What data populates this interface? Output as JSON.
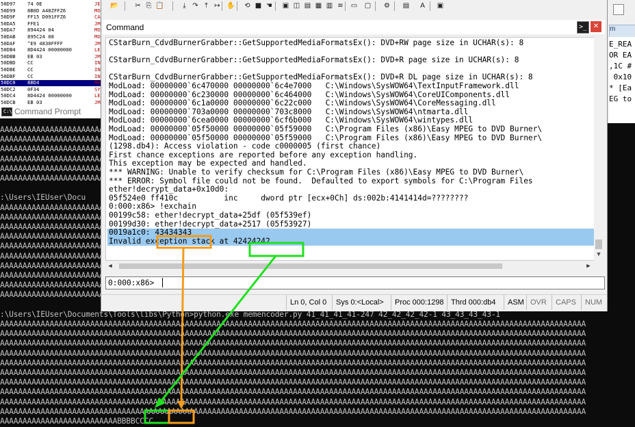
{
  "disasm": {
    "rows": [
      {
        "addr": "50D97",
        "ins": "74 0E"
      },
      {
        "addr": "50D99",
        "ins": "8B0D A48ZFFZ6"
      },
      {
        "addr": "50D9F",
        "ins": "FF15 D091FFZ6"
      },
      {
        "addr": "50DA5",
        "ins": "FFE1"
      },
      {
        "addr": "50DA7",
        "ins": "894424 04"
      },
      {
        "addr": "50DAB",
        "ins": "895C24 08"
      },
      {
        "addr": "50DAF",
        "ins": "^E9 4830FFFF"
      },
      {
        "addr": "50DB4",
        "ins": "8D4424 00000000"
      },
      {
        "addr": "50DBB",
        "ins": "EB 03"
      },
      {
        "addr": "50DBD",
        "ins": "CC"
      },
      {
        "addr": "50DBE",
        "ins": "CC"
      },
      {
        "addr": "50DBF",
        "ins": "CC"
      },
      {
        "addr": "50DC0",
        "ins": "8BD4"
      },
      {
        "addr": "50DC2",
        "ins": "0F34"
      },
      {
        "addr": "50DC4",
        "ins": "8D4424 00000000"
      },
      {
        "addr": "50DCB",
        "ins": "EB 03"
      }
    ],
    "mnemonics": [
      "JE",
      "MO",
      "CA",
      "JM",
      "MO",
      "MO",
      "JM",
      "LE",
      "JM",
      "IN",
      "IN",
      "IN",
      "MO",
      "SY",
      "LE",
      "JM"
    ]
  },
  "console": {
    "title": "Command Prompt",
    "lines": [
      "AAAAAAAAAAAAAAAAAAAAAAAAAA",
      "AAAAAAAAAAAAAAAAAAAAAAAAAA",
      "AAAAAAAAAAAAAAAAAAAAAAAAAA",
      "AAAAAAAAAAAAAAAAAAAAAAAAAA",
      "AAAAAAAAAAAAAAAAAAAAAAAAAA",
      "AAAAAAAAAAAAAAAAAAAAAAAAAA",
      "",
      ":\\Users\\IEUser\\Docu",
      "AAAAAAAAAAAAAAAAAAAAAAAAAA",
      "AAAAAAAAAAAAAAAAAAAAAAAAAA",
      "AAAAAAAAAAAAAAAAAAAAAAAAAA",
      "AAAAAAAAAAAAAAAAAAAAAAAAAA",
      "AAAAAAAAAAAAAAAAAAAAAAAAAA",
      "AAAAAAAAAAAAAAAAAAAAAAAAAA",
      "AAAAAAAAAAAAAAAAAAAAAAAAAA",
      "AAAAAAAAAAAAAAAAAAAAAAAAAA",
      "AAAAAAAAAAAAAAAAAAAAAAAAAA",
      "AAAAAAAAAAAAAAAAAAAAAAAAAA",
      "",
      ":\\Users\\IEUser\\Documents\\Tools\\libs\\Python>python.exe memencoder.py 41_41_41_41-247 42_42_42_42-1 43_43_43_43-1",
      "AAAAAAAAAAAAAAAAAAAAAAAAAAAAAAAAAAAAAAAAAAAAAAAAAAAAAAAAAAAAAAAAAAAAAAAAAAAAAAAAAAAAAAAAAAAAAAAAAAAAAAAAAAAAAAAAAAAAAAAAAAAAAAAAAA",
      "AAAAAAAAAAAAAAAAAAAAAAAAAAAAAAAAAAAAAAAAAAAAAAAAAAAAAAAAAAAAAAAAAAAAAAAAAAAAAAAAAAAAAAAAAAAAAAAAAAAAAAAAAAAAAAAAAAAAAAAAAAAAAAAAAA",
      "AAAAAAAAAAAAAAAAAAAAAAAAAAAAAAAAAAAAAAAAAAAAAAAAAAAAAAAAAAAAAAAAAAAAAAAAAAAAAAAAAAAAAAAAAAAAAAAAAAAAAAAAAAAAAAAAAAAAAAAAAAAAAAAAAA",
      "AAAAAAAAAAAAAAAAAAAAAAAAAAAAAAAAAAAAAAAAAAAAAAAAAAAAAAAAAAAAAAAAAAAAAAAAAAAAAAAAAAAAAAAAAAAAAAAAAAAAAAAAAAAAAAAAAAAAAAAAAAAAAAAAAA",
      "AAAAAAAAAAAAAAAAAAAAAAAAAAAAAAAAAAAAAAAAAAAAAAAAAAAAAAAAAAAAAAAAAAAAAAAAAAAAAAAAAAAAAAAAAAAAAAAAAAAAAAAAAAAAAAAAAAAAAAAAAAAAAAAAAA",
      "AAAAAAAAAAAAAAAAAAAAAAAAAAAAAAAAAAAAAAAAAAAAAAAAAAAAAAAAAAAAAAAAAAAAAAAAAAAAAAAAAAAAAAAAAAAAAAAAAAAAAAAAAAAAAAAAAAAAAAAAAAAAAAAAAA",
      "AAAAAAAAAAAAAAAAAAAAAAAAAAAAAAAAAAAAAAAAAAAAAAAAAAAAAAAAAAAAAAAAAAAAAAAAAAAAAAAAAAAAAAAAAAAAAAAAAAAAAAAAAAAAAAAAAAAAAAAAAAAAAAAAAA",
      "AAAAAAAAAAAAAAAAAAAAAAAAAAAAAAAAAAAAAAAAAAAAAAAAAAAAAAAAAAAAAAAAAAAAAAAAAAAAAAAAAAAAAAAAAAAAAAAAAAAAAAAAAAAAAAAAAAAAAAAAAAAAAAAAAA",
      "AAAAAAAAAAAAAAAAAAAAAAAAAAAAAAAAAAAAAAAAAAAAAAAAAAAAAAAAAAAAAAAAAAAAAAAAAAAAAAAAAAAAAAAAAAAAAAAAAAAAAAAAAAAAAAAAAAAAAAAAAAAAAAAAAA",
      "AAAAAAAAAAAAAAAAAAAAAAAAAAAAAAAAAAAAAAAAAAAAAAAAAAAAAAAAAAAAAAAAAAAAAAAAAAAAAAAAAAAAAAAAAAAAAAAAAAAAAAAAAAAAAAAAAAAAAAAAAAAAAAAAAA",
      "AAAAAAAAAAAAAAAAAAAAAAAAAABBBBCCCC"
    ]
  },
  "right_window": {
    "tab_label": "m",
    "code_lines": [
      "E_REA",
      "OR EA",
      ",1C #",
      " 0x10",
      "* [Ea",
      "EG to"
    ]
  },
  "command_window": {
    "title": "Command",
    "output_lines": [
      "CStarBurn_CdvdBurnerGrabber::GetSupportedMediaFormatsEx(): DVD+RW page size in UCHAR(s): 8",
      "",
      "CStarBurn_CdvdBurnerGrabber::GetSupportedMediaFormatsEx(): DVD+R page size in UCHAR(s): 8",
      "",
      "CStarBurn_CdvdBurnerGrabber::GetSupportedMediaFormatsEx(): DVD+R DL page size in UCHAR(s): 8",
      "ModLoad: 00000000`6c470000 00000000`6c4e7000   C:\\Windows\\SysWOW64\\TextInputFramework.dll",
      "ModLoad: 00000000`6c230000 00000000`6c464000   C:\\Windows\\SysWOW64\\CoreUIComponents.dll",
      "ModLoad: 00000000`6c1a0000 00000000`6c22c000   C:\\Windows\\SysWOW64\\CoreMessaging.dll",
      "ModLoad: 00000000`703a0000 00000000`703c8000   C:\\Windows\\SysWOW64\\ntmarta.dll",
      "ModLoad: 00000000`6cea0000 00000000`6cf6b000   C:\\Windows\\SysWOW64\\wintypes.dll",
      "ModLoad: 00000000`05f50000 00000000`05f59000   C:\\Program Files (x86)\\Easy MPEG to DVD Burner\\",
      "ModLoad: 00000000`05f50000 00000000`05f59000   C:\\Program Files (x86)\\Easy MPEG to DVD Burner\\",
      "(1298.db4): Access violation - code c0000005 (first chance)",
      "First chance exceptions are reported before any exception handling.",
      "This exception may be expected and handled.",
      "*** WARNING: Unable to verify checksum for C:\\Program Files (x86)\\Easy MPEG to DVD Burner\\",
      "*** ERROR: Symbol file could not be found.  Defaulted to export symbols for C:\\Program Files",
      "ether!decrypt_data+0x10d0:",
      "05f524e0 ff410c          inc     dword ptr [ecx+0Ch] ds:002b:4141414d=????????",
      "0:000:x86> !exchain",
      "00199c58: ether!decrypt_data+25df (05f539ef)",
      "00199d30: ether!decrypt_data+2517 (05f53927)",
      "0019a1c0: 43434343",
      "Invalid exception stack at 42424242"
    ],
    "prompt": "0:000:x86>",
    "input_value": ""
  },
  "status_bar": {
    "position": "Ln 0, Col 0",
    "sys": "Sys 0:<Local>",
    "proc": "Proc 000:1298",
    "thrd": "Thrd 000:db4",
    "asm": "ASM",
    "ovr": "OVR",
    "caps": "CAPS",
    "num": "NUM"
  },
  "annotation": {
    "seh_handler_value": "43434343",
    "next_seh_value": "42424242",
    "bbbb": "BBBB",
    "cccc": "CCCC",
    "colors": {
      "orange": "#f29b1d",
      "green": "#20e020"
    }
  },
  "toolbar": {
    "icons": [
      "open-icon",
      "cut-icon",
      "copy-icon",
      "paste-icon",
      "step-into-icon",
      "step-over-icon",
      "step-out-icon",
      "run-to-cursor-icon",
      "break-icon",
      "restart-icon",
      "stop-icon",
      "hand-icon",
      "command-window-icon",
      "watch-icon",
      "locals-icon",
      "registers-icon",
      "memory-icon",
      "call-stack-icon",
      "disassembly-icon",
      "scratch-pad-icon",
      "options-icon",
      "source-mode-icon",
      "font-icon",
      "properties-icon"
    ]
  }
}
